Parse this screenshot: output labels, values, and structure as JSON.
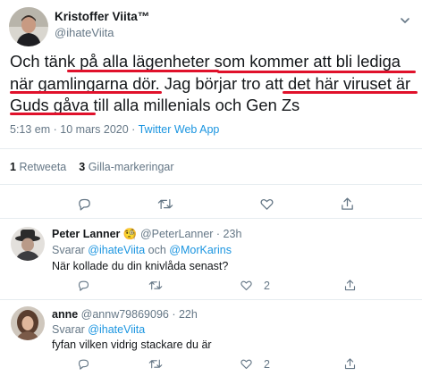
{
  "main_tweet": {
    "author_name": "Kristoffer Viita™",
    "author_handle": "@ihateViita",
    "text_lines": [
      "Och tänk på alla lägenheter som kommer att bli lediga",
      "när gamlingarna dör. Jag börjar tro att det här viruset är",
      "Guds gåva till alla millenials och Gen Zs"
    ],
    "time": "5:13 em · 10 mars 2020 · ",
    "client": "Twitter Web App",
    "retweets_count": "1",
    "retweets_label": "Retweeta",
    "likes_count": "3",
    "likes_label": "Gilla-markeringar"
  },
  "replies": [
    {
      "name": "Peter Lanner",
      "emoji": "🧐",
      "handle_time": " @PeterLanner · 23h",
      "replying_prefix": "Svarar ",
      "replying_to_1": "@ihateViita",
      "replying_and": " och ",
      "replying_to_2": "@MorKarins",
      "text": "När kollade du din knivlåda senast?",
      "likes": "2"
    },
    {
      "name": "anne",
      "handle_time": " @annw79869096 · 22h",
      "replying_prefix": "Svarar ",
      "replying_to_1": "@ihateViita",
      "text": "fyfan vilken vidrig stackare du är",
      "likes": "2"
    }
  ],
  "icons": [
    "chevron-down-icon",
    "reply-icon",
    "retweet-icon",
    "like-icon",
    "share-icon"
  ],
  "colors": {
    "link": "#1b95e0",
    "muted": "#657786",
    "text": "#14171a",
    "annotation": "#e0112b",
    "divider": "#e6ecf0"
  }
}
